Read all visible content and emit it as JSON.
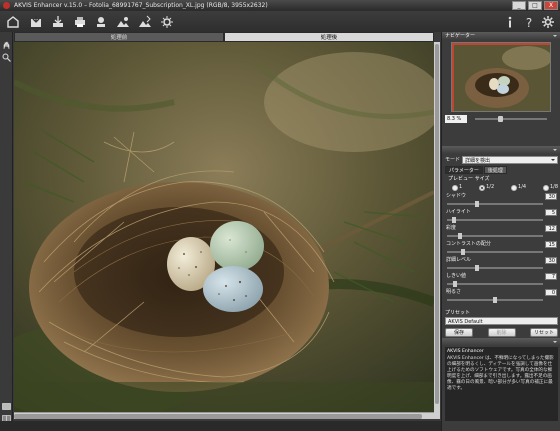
{
  "window": {
    "title": "AKVIS Enhancer v.15.0 – Fotolia_68991767_Subscription_XL.jpg (RGB/8, 3955x2632)",
    "minimize": "_",
    "maximize": "□",
    "close": "X"
  },
  "toolbar": {
    "icons": [
      "home-icon",
      "open-icon",
      "save-icon",
      "print-icon",
      "import-preset-icon",
      "export-preset-icon",
      "share-icon",
      "batch-icon",
      "settings-effect-icon"
    ],
    "right_icons": [
      "info-icon",
      "help-icon",
      "preferences-icon"
    ]
  },
  "tabs": {
    "before": "処理前",
    "after": "処理後"
  },
  "navigator": {
    "header": "ナビゲーター",
    "zoom": "8.3 %",
    "zoom_level": 0.35
  },
  "settings": {
    "mode_label": "モード",
    "mode_value": "詳細を検出",
    "subtab_params": "パラメーター",
    "subtab_post": "後処理",
    "preview_size_label": "プレビュー サイズ",
    "preview_options": [
      "1",
      "1/2",
      "1/4",
      "1/8"
    ],
    "preview_selected": 1,
    "params": [
      {
        "label": "シャドウ",
        "value": "30",
        "level": 0.3
      },
      {
        "label": "ハイライト",
        "value": "5",
        "level": 0.05
      },
      {
        "label": "彩度",
        "value": "12",
        "level": 0.12
      },
      {
        "label": "コントラストの配分",
        "value": "15",
        "level": 0.15
      },
      {
        "label": "詳細レベル",
        "value": "30",
        "level": 0.3
      },
      {
        "label": "しきい値",
        "value": "7",
        "level": 0.07
      },
      {
        "label": "明るさ",
        "value": "0",
        "level": 0.5
      }
    ],
    "preset_label": "プリセット",
    "preset_value": "AKVIS Default",
    "btn_save": "保存",
    "btn_delete": "削除",
    "btn_reset": "リセット"
  },
  "help": {
    "title": "AKVIS Enhancer",
    "text": "AKVIS Enhancer は、不鮮明になってしまった撮影の細部を明るくし、ディテールを強調して画像を仕上げるためのソフトウェアです。写真の全体的な鮮明度を上げ、細部まで引き出します。露出不足の画像、霧の日の風景、暗い部分が多い写真の補正に最適です。"
  },
  "colors": {
    "accent": "#c0302a",
    "panel_bg": "#3c3c3c"
  }
}
